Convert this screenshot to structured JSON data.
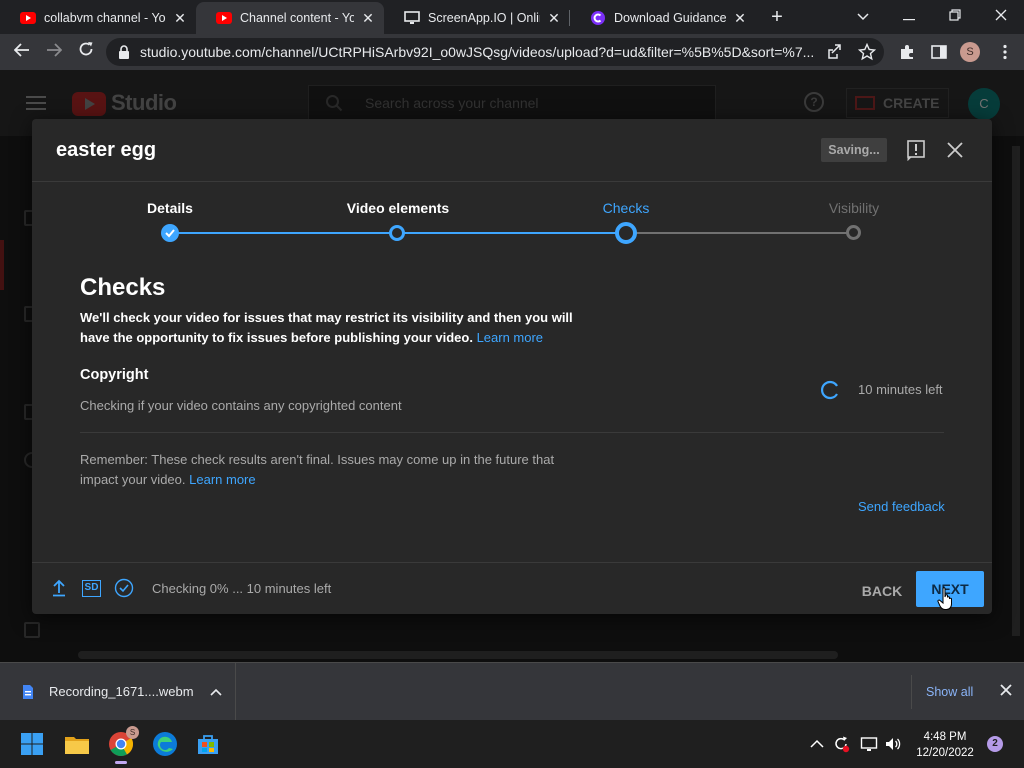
{
  "browser": {
    "tabs": [
      {
        "title": "collabvm channel - You",
        "active": false
      },
      {
        "title": "Channel content - YouT",
        "active": true
      },
      {
        "title": "ScreenApp.IO | Online",
        "active": false
      },
      {
        "title": "Download Guidance",
        "active": false
      }
    ],
    "url": "studio.youtube.com/channel/UCtRPHiSArbv92I_o0wJSQsg/videos/upload?d=ud&filter=%5B%5D&sort=%7...",
    "profile_initial": "S"
  },
  "studio": {
    "logo_text": "Studio",
    "search_placeholder": "Search across your channel",
    "create_label": "CREATE",
    "avatar_initial": "C"
  },
  "dialog": {
    "title": "easter egg",
    "saving_label": "Saving...",
    "steps": [
      {
        "label": "Details",
        "state": "done"
      },
      {
        "label": "Video elements",
        "state": "done"
      },
      {
        "label": "Checks",
        "state": "current"
      },
      {
        "label": "Visibility",
        "state": "todo"
      }
    ],
    "section_title": "Checks",
    "section_desc": "We'll check your video for issues that may restrict its visibility and then you will have the opportunity to fix issues before publishing your video.",
    "learn_more": "Learn more",
    "copyright_title": "Copyright",
    "copyright_desc": "Checking if your video contains any copyrighted content",
    "time_left": "10 minutes left",
    "remember_text": "Remember: These check results aren't final. Issues may come up in the future that impact your video.",
    "remember_link": "Learn more",
    "send_feedback": "Send feedback",
    "footer_status": "Checking 0% ... 10 minutes left",
    "sd_badge": "SD",
    "back_label": "BACK",
    "next_label": "NEXT"
  },
  "downloads": {
    "file_name": "Recording_1671....webm",
    "show_all": "Show all"
  },
  "taskbar": {
    "time": "4:48 PM",
    "date": "12/20/2022",
    "notification_count": "2",
    "chrome_badge": "S"
  },
  "colors": {
    "accent_blue": "#3ea6ff",
    "youtube_red": "#ff0000",
    "dialog_bg": "#282828"
  }
}
